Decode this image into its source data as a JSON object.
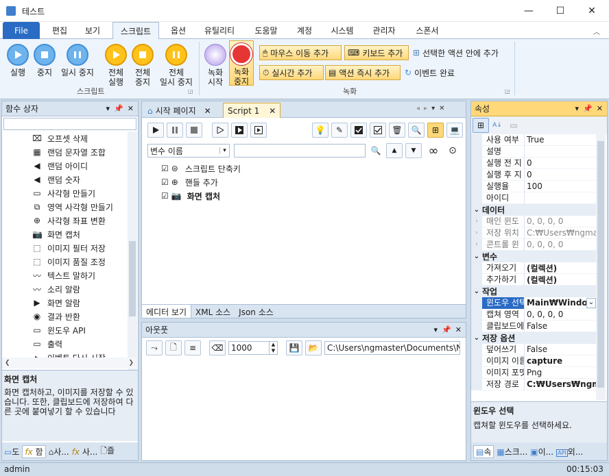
{
  "window": {
    "title": "테스트",
    "minimize": "—",
    "maximize": "☐",
    "close": "✕"
  },
  "menu": {
    "file": "File",
    "tabs": [
      "편집",
      "보기",
      "스크립트",
      "옵션",
      "유틸리티",
      "도움말",
      "계정",
      "시스템",
      "관리자",
      "스폰서"
    ]
  },
  "ribbon": {
    "script_group_label": "스크립트",
    "record_group_label": "녹화",
    "buttons": {
      "run": "실행",
      "stop": "중지",
      "pause": "일시 중지",
      "run_all_1": "전체",
      "run_all_2": "실행",
      "stop_all_1": "전체",
      "stop_all_2": "중지",
      "pause_all_1": "전체",
      "pause_all_2": "일시 중지",
      "record_start_1": "녹화",
      "record_start_2": "시작",
      "record_stop_1": "녹화",
      "record_stop_2": "중지",
      "add_mouse_move": "마우스 이동 추가",
      "add_keyboard": "키보드 추가",
      "add_in_selected": "선택한 액션 안에 추가",
      "add_realtime": "실시간 추가",
      "add_action_now": "액션 즉시 추가",
      "event_done": "이벤트 완료"
    }
  },
  "function_box": {
    "title": "함수 상자",
    "search_value": "",
    "items": [
      "오프셋 삭제",
      "랜덤 문자열 조합",
      "랜덤 아이디",
      "랜덤 숫자",
      "사각형 만들기",
      "영역 사각형 만들기",
      "사각형 좌표 변환",
      "화면 캡처",
      "이미지 필터 저장",
      "이미지 품질 조정",
      "텍스트 말하기",
      "소리 알람",
      "화면 알람",
      "결과 반환",
      "윈도우 API",
      "출력",
      "이벤트 다시 시작"
    ],
    "desc_title": "화면 캡처",
    "desc_text": "화면 캡처하고, 이미지를 저장할 수 있습니다. 또한, 클립보드에 저장하여 다른 곳에 붙여넣기 할 수 있습니다",
    "bottom_tabs": [
      "도",
      "함",
      "사...",
      "사...",
      "즐"
    ]
  },
  "editor": {
    "tabs": [
      "시작 페이지",
      "Script 1"
    ],
    "var_select": "변수 이름",
    "var_input": "",
    "tree": [
      "스크립트 단축키",
      "핸들 추가",
      "화면 캡처"
    ],
    "bottom_tabs": [
      "에디터 보기",
      "XML 소스",
      "Json 소스"
    ]
  },
  "output": {
    "title": "아웃풋",
    "count": "1000",
    "path": "C:\\Users\\ngmaster\\Documents\\NGM"
  },
  "properties": {
    "title": "속성",
    "rows": [
      {
        "k": "사용 여부",
        "v": "True"
      },
      {
        "k": "설명",
        "v": ""
      },
      {
        "k": "실행 전 지",
        "v": "0"
      },
      {
        "k": "실행 후 지",
        "v": "0"
      },
      {
        "k": "실행율",
        "v": "100"
      },
      {
        "k": "아이디",
        "v": ""
      },
      {
        "k": "데이터",
        "v": "",
        "cat": true
      },
      {
        "k": "매인 윈도",
        "v": "0, 0, 0, 0",
        "gray": true
      },
      {
        "k": "저장 위치",
        "v": "C:₩Users₩ngma",
        "gray": true
      },
      {
        "k": "콘트롤 윈",
        "v": "0, 0, 0, 0",
        "gray": true
      },
      {
        "k": "변수",
        "v": "",
        "cat": true
      },
      {
        "k": "가져오기",
        "v": "(컬렉션)",
        "bold": true
      },
      {
        "k": "추가하기",
        "v": "(컬렉션)",
        "bold": true
      },
      {
        "k": "작업",
        "v": "",
        "cat": true
      },
      {
        "k": "윈도우 선택",
        "v": "Main₩Window",
        "bold": true,
        "sel": true
      },
      {
        "k": "캡쳐 영역",
        "v": "0, 0, 0, 0"
      },
      {
        "k": "클립보드에",
        "v": "False"
      },
      {
        "k": "저장 옵션",
        "v": "",
        "cat": true
      },
      {
        "k": "덮어쓰기",
        "v": "False"
      },
      {
        "k": "이미지 이름",
        "v": "capture",
        "bold": true
      },
      {
        "k": "이미지 포맷",
        "v": "Png"
      },
      {
        "k": "저장 경로",
        "v": "C:₩Users₩ngm",
        "bold": true
      }
    ],
    "desc_title": "윈도우 선택",
    "desc_text": "캡쳐할 윈도우를 선택하세요.",
    "bottom_tabs": [
      "속",
      "스크...",
      "이...",
      "외..."
    ]
  },
  "status": {
    "user": "admin",
    "time": "00:15:03"
  },
  "colors": {
    "accent": "#2a6bc4",
    "ribbon_bg": "#eef4fb",
    "panel_hd": "#d9e4f1",
    "highlight": "#ffd87a"
  }
}
